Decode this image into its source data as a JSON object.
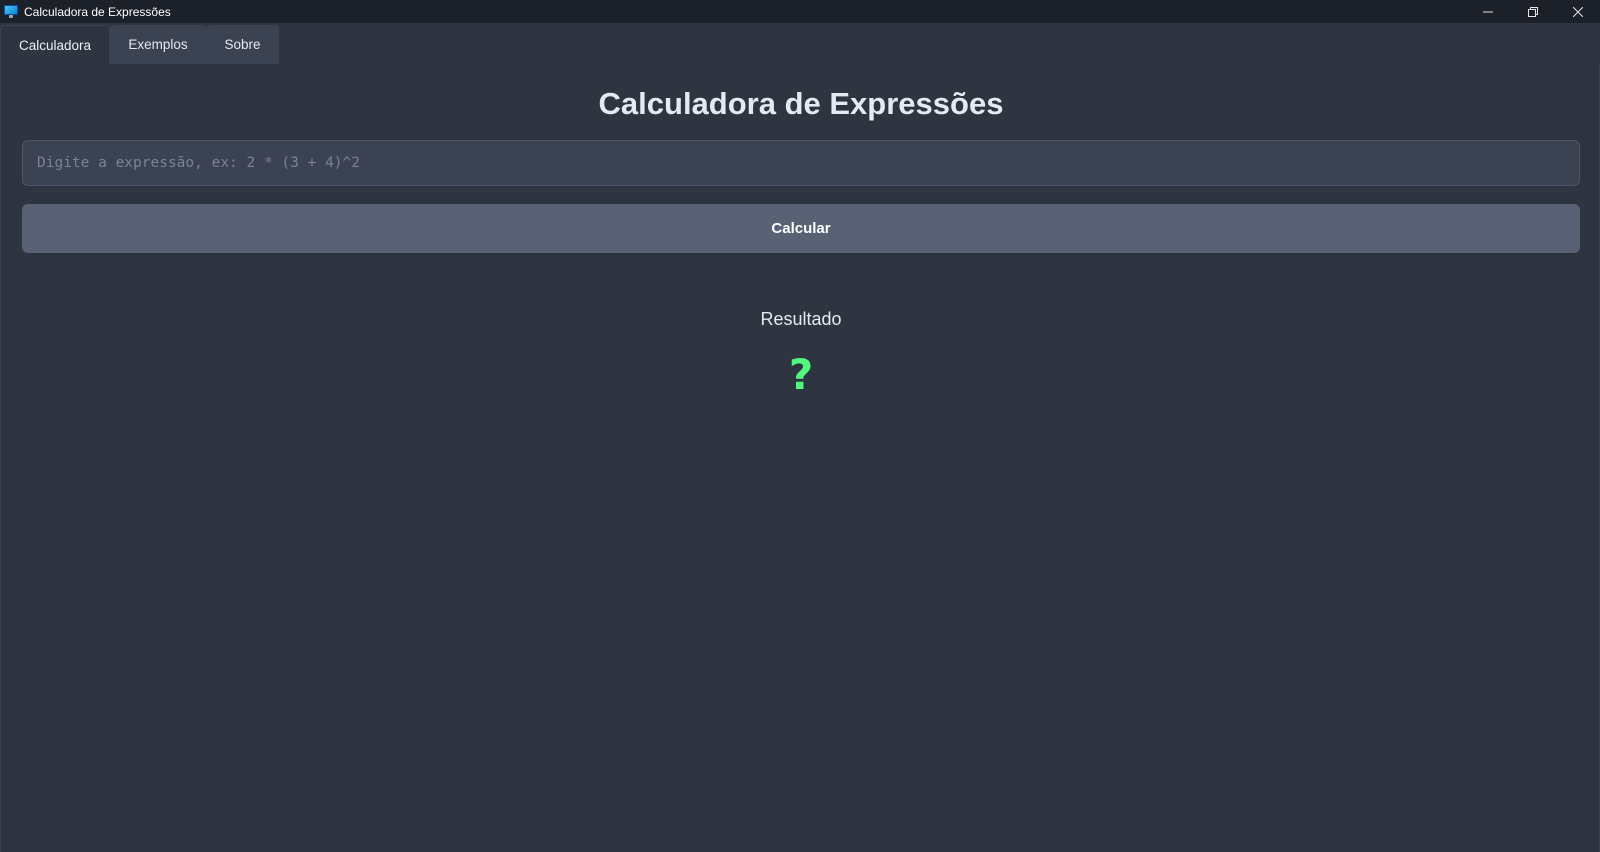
{
  "window": {
    "title": "Calculadora de Expressões",
    "icon": "monitor-icon"
  },
  "tabs": [
    {
      "label": "Calculadora",
      "active": true
    },
    {
      "label": "Exemplos",
      "active": false
    },
    {
      "label": "Sobre",
      "active": false
    }
  ],
  "main": {
    "title": "Calculadora de Expressões",
    "expression_input": {
      "value": "",
      "placeholder": "Digite a expressão, ex: 2 * (3 + 4)^2"
    },
    "calculate_button_label": "Calcular",
    "result_label": "Resultado",
    "result_value": "?"
  },
  "colors": {
    "background": "#2e3440",
    "titlebar": "#1c2029",
    "input_background": "#3b4252",
    "button_background": "#596275",
    "result_accent": "#50fa7b"
  }
}
